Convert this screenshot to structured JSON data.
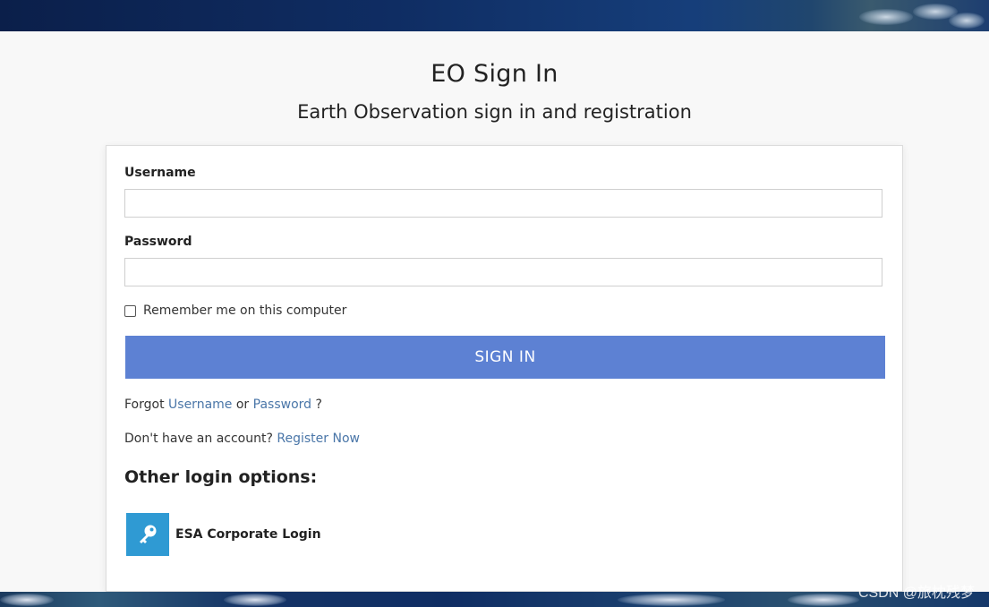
{
  "header": {
    "title": "EO Sign In",
    "subtitle": "Earth Observation sign in and registration"
  },
  "form": {
    "username_label": "Username",
    "username_value": "",
    "password_label": "Password",
    "password_value": "",
    "remember_label": "Remember me on this computer",
    "remember_checked": false,
    "submit_label": "SIGN IN"
  },
  "forgot": {
    "prefix": "Forgot",
    "username_link": "Username",
    "or_text": "or",
    "password_link": "Password",
    "suffix": "?"
  },
  "register": {
    "prefix": "Don't have an account?",
    "link": "Register Now"
  },
  "other_login": {
    "title": "Other login options:",
    "options": [
      {
        "label": "ESA Corporate Login",
        "icon": "key-icon"
      }
    ]
  },
  "watermark": "CSDN @旅枕残梦",
  "colors": {
    "accent": "#5d81d3",
    "link": "#4a76a8",
    "sso_icon_bg": "#2f9ad3"
  }
}
